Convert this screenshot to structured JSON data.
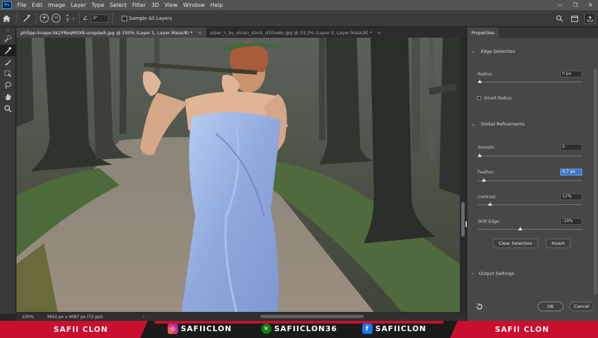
{
  "app": {
    "logo": "Ps"
  },
  "menu": [
    "File",
    "Edit",
    "Image",
    "Layer",
    "Type",
    "Select",
    "Filter",
    "3D",
    "View",
    "Window",
    "Help"
  ],
  "window_controls": {
    "minimize": "—",
    "restore": "❐",
    "close": "✕"
  },
  "options_bar": {
    "brush_size": "7",
    "angle": "0°",
    "sample_all_layers": "Sample All Layers"
  },
  "tabs": [
    {
      "label": "philipp-knape-hk2YReqM5X8-unsplash.jpg @ 100% (Layer 1, Layer Mask/8) *",
      "close": "×",
      "active": true
    },
    {
      "label": "piper_ii_by_eirian_stock_d10ns6c.jpg @ 33,3% (Layer 0, Layer Mask/8) *",
      "close": "×",
      "active": false
    }
  ],
  "status": {
    "zoom": "100%",
    "dimensions": "3602 px x 4087 px (72 ppi)",
    "arrow": "›"
  },
  "properties": {
    "tab_label": "Properties",
    "edge_detection": "Edge Detection",
    "radius_label": "Radius:",
    "radius_value": "0 px",
    "radius_level": 0.02,
    "smart_radius": "Smart Radius",
    "global_refinements": "Global Refinements",
    "smooth_label": "Smooth:",
    "smooth_value": "0",
    "smooth_level": 0.02,
    "feather_label": "Feather:",
    "feather_value": "0,7 px",
    "feather_level": 0.06,
    "contrast_label": "Contrast:",
    "contrast_value": "12%",
    "contrast_level": 0.12,
    "shift_label": "Shift Edge:",
    "shift_value": "-19%",
    "shift_level": 0.41,
    "clear_selection": "Clear Selection",
    "invert": "Invert",
    "output_settings": "Output Settings",
    "ok": "OK",
    "cancel": "Cancel"
  },
  "banner": {
    "left": "SAFII CLON",
    "instagram": "SAFIICLON",
    "xbox": "SAFIICLON36",
    "facebook": "SAFIICLON",
    "right": "SAFII CLON"
  },
  "colors": {
    "accent": "#3a77c9",
    "banner_red": "#c8102e",
    "photoshop_blue": "#31a8ff"
  }
}
